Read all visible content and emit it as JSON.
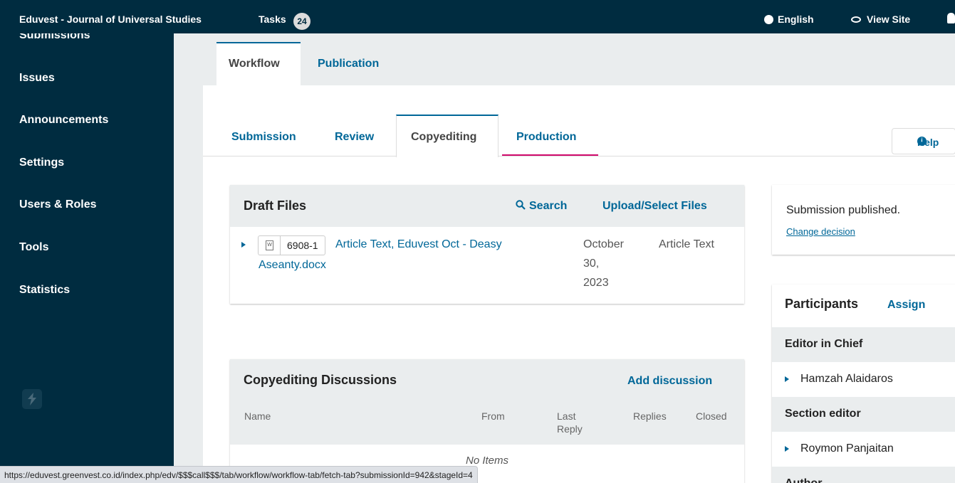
{
  "topbar": {
    "site_title": "Eduvest - Journal of Universal Studies",
    "tasks_label": "Tasks",
    "tasks_count": "24",
    "language": "English",
    "view_site": "View Site"
  },
  "sidebar": {
    "items": [
      "Submissions",
      "Issues",
      "Announcements",
      "Settings",
      "Users & Roles",
      "Tools",
      "Statistics"
    ]
  },
  "workflow_tabs": {
    "workflow": "Workflow",
    "publication": "Publication"
  },
  "stage_tabs": {
    "submission": "Submission",
    "review": "Review",
    "copyediting": "Copyediting",
    "production": "Production"
  },
  "help": "Help",
  "draft_files": {
    "title": "Draft Files",
    "search": "Search",
    "upload": "Upload/Select Files",
    "file": {
      "id": "6908-1",
      "name": "Article Text, Eduvest Oct - Deasy Aseanty.docx",
      "date_line1": "October",
      "date_line2": "30,",
      "date_line3": "2023",
      "type": "Article Text"
    }
  },
  "discussions": {
    "title": "Copyediting Discussions",
    "add": "Add discussion",
    "columns": {
      "name": "Name",
      "from": "From",
      "last_reply_1": "Last",
      "last_reply_2": "Reply",
      "replies": "Replies",
      "closed": "Closed"
    },
    "empty": "No Items"
  },
  "status": {
    "text": "Submission published.",
    "change": "Change decision"
  },
  "participants": {
    "title": "Participants",
    "assign": "Assign",
    "groups": {
      "editor_in_chief": "Editor in Chief",
      "editor_name": "Hamzah Alaidaros",
      "section_editor": "Section editor",
      "section_name": "Roymon Panjaitan",
      "author": "Author"
    }
  },
  "statusbar_url": "https://eduvest.greenvest.co.id/index.php/edv/$$$call$$$/tab/workflow/workflow-tab/fetch-tab?submissionId=942&stageId=4"
}
